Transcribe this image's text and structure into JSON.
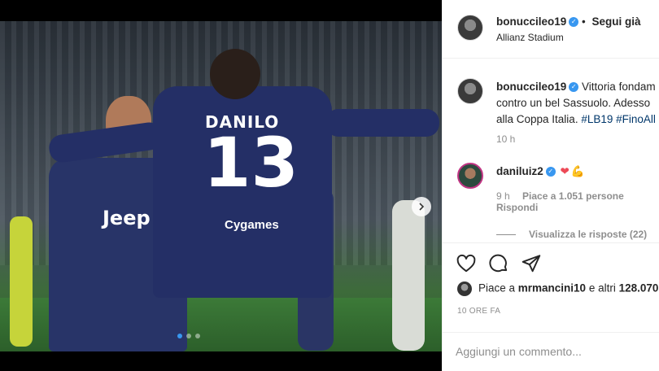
{
  "photo": {
    "jersey_name": "DANILO",
    "jersey_number": "13",
    "back_sponsor": "Cygames",
    "front_sponsor": "Jeep",
    "carousel": {
      "total_slides": 3,
      "active_slide": 1
    },
    "next_icon": "chevron-right-icon"
  },
  "header": {
    "username": "bonuccileo19",
    "verified_icon": "verified-badge-icon",
    "separator": "•",
    "follow_status": "Segui già",
    "location": "Allianz Stadium"
  },
  "caption": {
    "username": "bonuccileo19",
    "text_line1": "Vittoria fondam",
    "text_line2": "contro un bel Sassuolo. Adesso",
    "text_line3_prefix": "alla Coppa Italia. ",
    "hashtags": "#LB19 #FinoAll",
    "time": "10 h"
  },
  "comment": {
    "username": "daniluiz2",
    "heart_icon": "heart-emoji-icon",
    "muscle_icon": "flexed-biceps-emoji-icon",
    "time": "9 h",
    "likes": "Piace a 1.051 persone",
    "reply": "Rispondi",
    "view_replies": "Visualizza le risposte (22)"
  },
  "actions": {
    "like_icon": "heart-outline-icon",
    "comment_icon": "comment-bubble-icon",
    "share_icon": "paper-plane-icon",
    "likes_prefix": "Piace a ",
    "likes_user": "mrmancini10",
    "likes_suffix": " e altri ",
    "likes_count": "128.070",
    "date": "10 ORE FA"
  },
  "add_comment": {
    "placeholder": "Aggiungi un commento..."
  },
  "colors": {
    "link_blue": "#00376b",
    "verified_blue": "#3897f0",
    "heart_red": "#ed4956",
    "jersey_navy": "#242f66"
  }
}
